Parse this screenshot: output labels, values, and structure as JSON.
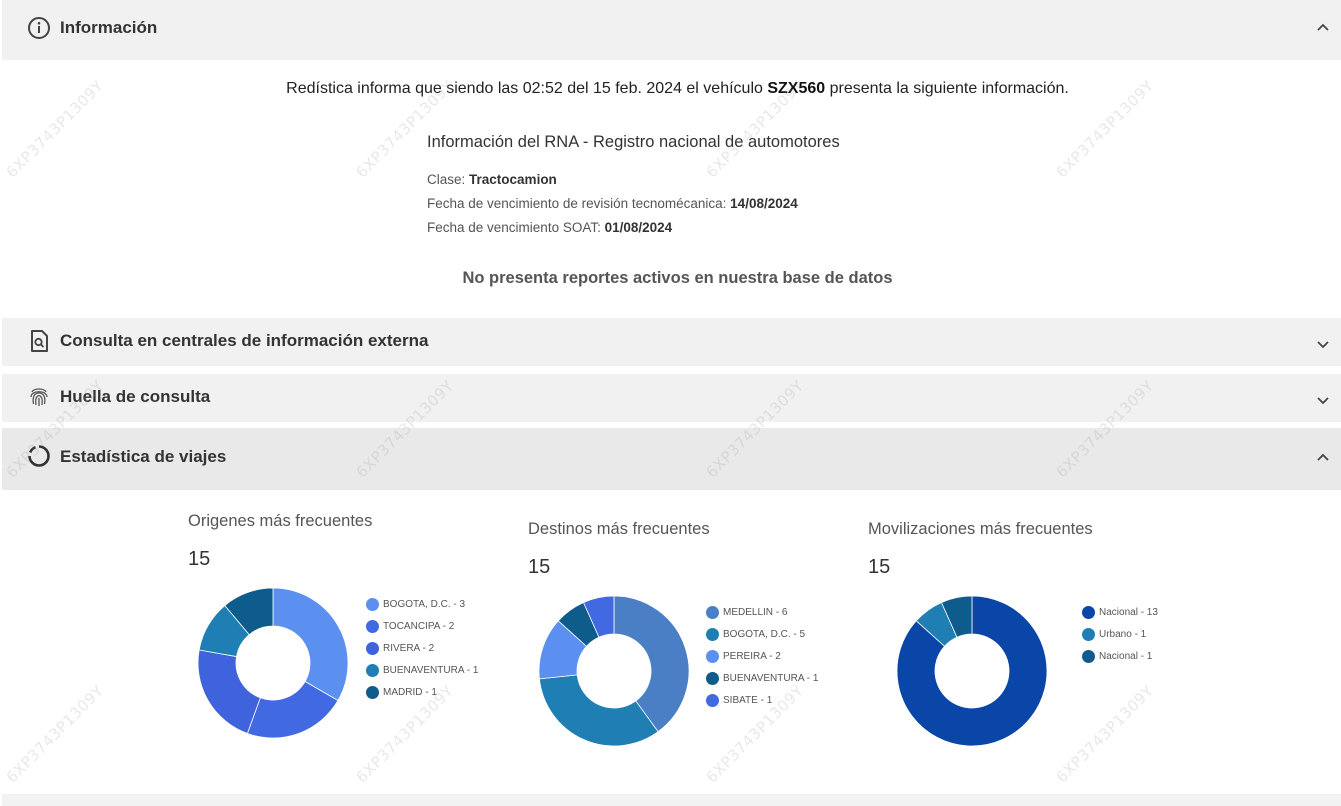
{
  "sections": {
    "informacion": {
      "title": "Información",
      "icon": "info-icon",
      "expanded": true
    },
    "centrales": {
      "title": "Consulta en centrales de información externa",
      "icon": "document-search-icon",
      "expanded": false
    },
    "huella": {
      "title": "Huella de consulta",
      "icon": "fingerprint-icon",
      "expanded": false
    },
    "estadistica": {
      "title": "Estadística de viajes",
      "icon": "donut-icon",
      "expanded": true
    }
  },
  "info": {
    "intro_pre": "Redística informa que siendo las 02:52 del 15 feb. 2024 el vehículo ",
    "plate": "SZX560",
    "intro_post": " presenta la siguiente información.",
    "rna_title": "Información del RNA - Registro nacional de automotores",
    "clase_label": "Clase: ",
    "clase_value": "Tractocamion",
    "tecno_label": "Fecha de vencimiento de revisión tecnomécanica: ",
    "tecno_value": "14/08/2024",
    "soat_label": "Fecha de vencimiento SOAT: ",
    "soat_value": "01/08/2024",
    "no_reports": "No presenta reportes activos en nuestra base de datos"
  },
  "watermark": "6XP3743P1309Y",
  "chart_data": [
    {
      "type": "pie",
      "title": "Origenes más frecuentes",
      "total": "15",
      "series": [
        {
          "label": "BOGOTA, D.C. - 3",
          "name": "BOGOTA, D.C.",
          "value": 3,
          "color": "#5b8ff0"
        },
        {
          "label": "TOCANCIPA - 2",
          "name": "TOCANCIPA",
          "value": 2,
          "color": "#4169e1"
        },
        {
          "label": "RIVERA - 2",
          "name": "RIVERA",
          "value": 2,
          "color": "#3f63dc"
        },
        {
          "label": "BUENAVENTURA - 1",
          "name": "BUENAVENTURA",
          "value": 1,
          "color": "#1f7fb4"
        },
        {
          "label": "MADRID - 1",
          "name": "MADRID",
          "value": 1,
          "color": "#0d5c8c"
        }
      ]
    },
    {
      "type": "pie",
      "title": "Destinos más frecuentes",
      "total": "15",
      "series": [
        {
          "label": "MEDELLIN - 6",
          "name": "MEDELLIN",
          "value": 6,
          "color": "#4a7fc6"
        },
        {
          "label": "BOGOTA, D.C. - 5",
          "name": "BOGOTA, D.C.",
          "value": 5,
          "color": "#1f7fb4"
        },
        {
          "label": "PEREIRA - 2",
          "name": "PEREIRA",
          "value": 2,
          "color": "#5b8ff0"
        },
        {
          "label": "BUENAVENTURA - 1",
          "name": "BUENAVENTURA",
          "value": 1,
          "color": "#0d5c8c"
        },
        {
          "label": "SIBATE - 1",
          "name": "SIBATE",
          "value": 1,
          "color": "#4169e1"
        }
      ]
    },
    {
      "type": "pie",
      "title": "Movilizaciones más frecuentes",
      "total": "15",
      "series": [
        {
          "label": "Nacional - 13",
          "name": "Nacional",
          "value": 13,
          "color": "#0a45a8"
        },
        {
          "label": "Urbano - 1",
          "name": "Urbano",
          "value": 1,
          "color": "#1f7fb4"
        },
        {
          "label": "Nacional - 1",
          "name": "Nacional",
          "value": 1,
          "color": "#0d5c8c"
        }
      ]
    }
  ]
}
